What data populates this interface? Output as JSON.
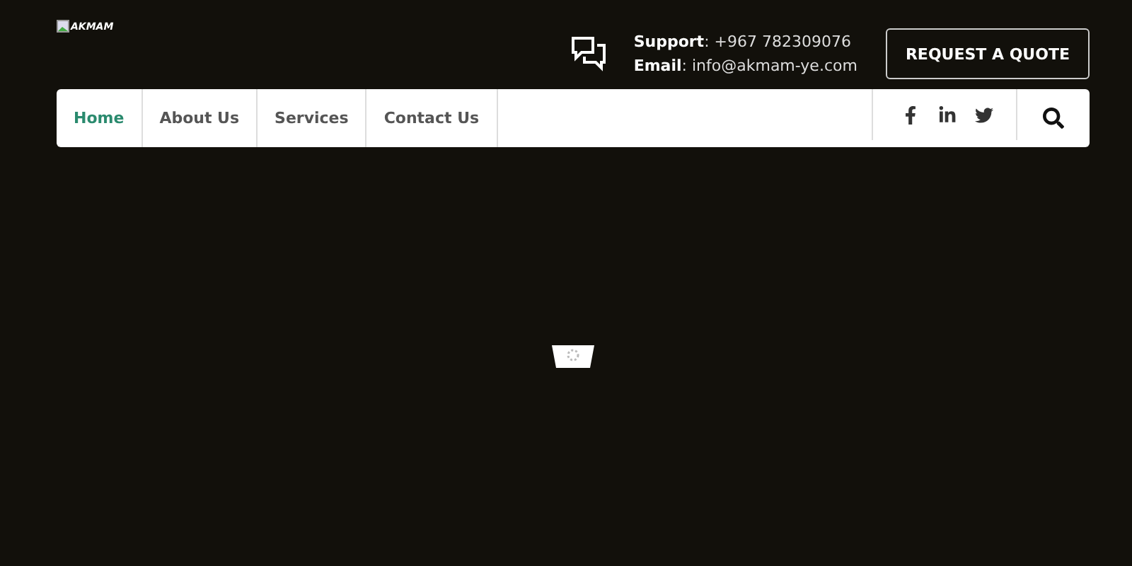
{
  "logo": {
    "alt": "AKMAM"
  },
  "contact": {
    "support_label": "Support",
    "support_value": ": +967 782309076",
    "email_label": "Email",
    "email_value": ": info@akmam-ye.com"
  },
  "quote_button": "REQUEST A QUOTE",
  "nav": [
    {
      "label": "Home",
      "selected": true
    },
    {
      "label": "About Us",
      "selected": false
    },
    {
      "label": "Services",
      "selected": false
    },
    {
      "label": "Contact Us",
      "selected": false
    }
  ]
}
